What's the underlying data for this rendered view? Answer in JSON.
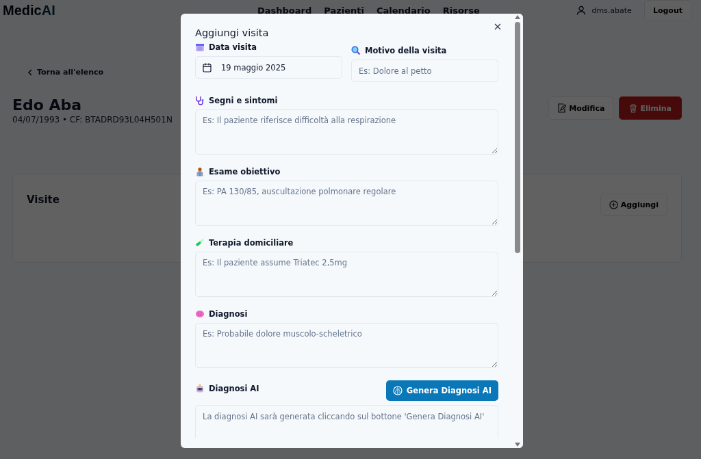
{
  "nav": {
    "logo": [
      "Medic",
      "AI"
    ],
    "links": [
      "Dashboard",
      "Pazienti",
      "Calendario",
      "Risorse"
    ],
    "user": "dms.abate",
    "logout": "Logout"
  },
  "page": {
    "back": "Torna all'elenco",
    "patient_name": "Edo Aba",
    "patient_info": "04/07/1993 • CF: BTADRD93L04H501N",
    "edit": "Modifica",
    "delete": "Elimina",
    "visits_title": "Visite",
    "add": "Aggiungi"
  },
  "modal": {
    "title": "Aggiungi visita",
    "date_field": {
      "label": "Data visita",
      "value": "19 maggio 2025"
    },
    "reason_field": {
      "label": "Motivo della visita",
      "placeholder": "Es: Dolore al petto"
    },
    "textareas": [
      {
        "kind": "symptoms",
        "label": "Segni e sintomi",
        "placeholder": "Es: Il paziente riferisce difficoltà alla respirazione"
      },
      {
        "kind": "exam",
        "label": "Esame obiettivo",
        "placeholder": "Es: PA 130/85, auscultazione polmonare regolare"
      },
      {
        "kind": "therapy",
        "label": "Terapia domiciliare",
        "placeholder": "Es: Il paziente assume Triatec 2,5mg"
      },
      {
        "kind": "diagnosis",
        "label": "Diagnosi",
        "placeholder": "Es: Probabile dolore muscolo-scheletrico"
      }
    ],
    "ai": {
      "label": "Diagnosi AI",
      "button": "Genera Diagnosi AI",
      "placeholder": "La diagnosi AI sarà generata cliccando sul bottone 'Genera Diagnosi AI'"
    }
  }
}
